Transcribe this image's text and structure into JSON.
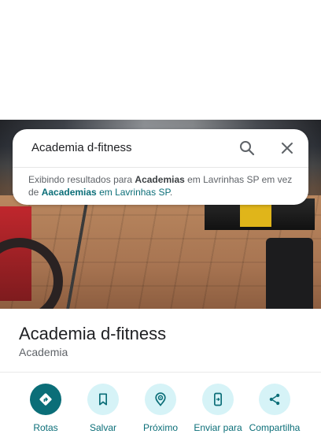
{
  "search": {
    "query": "Academia d-fitness",
    "notice_prefix": "Exibindo resultados para ",
    "notice_term": "Academias",
    "notice_middle": " em Lavrinhas SP em vez de ",
    "notice_link_term": "Aacademias",
    "notice_link_rest": " em Lavrinhas SP",
    "notice_suffix": "."
  },
  "place": {
    "name": "Academia d-fitness",
    "category": "Academia"
  },
  "actions": [
    {
      "label": "Rotas",
      "icon": "directions-icon"
    },
    {
      "label": "Salvar",
      "icon": "bookmark-icon"
    },
    {
      "label": "Próximo",
      "icon": "nearby-icon"
    },
    {
      "label": "Enviar para",
      "icon": "send-to-phone-icon"
    },
    {
      "label": "Compartilha",
      "icon": "share-icon"
    }
  ],
  "colors": {
    "accent": "#0b6e78",
    "action_bg": "#d6f3f7"
  }
}
